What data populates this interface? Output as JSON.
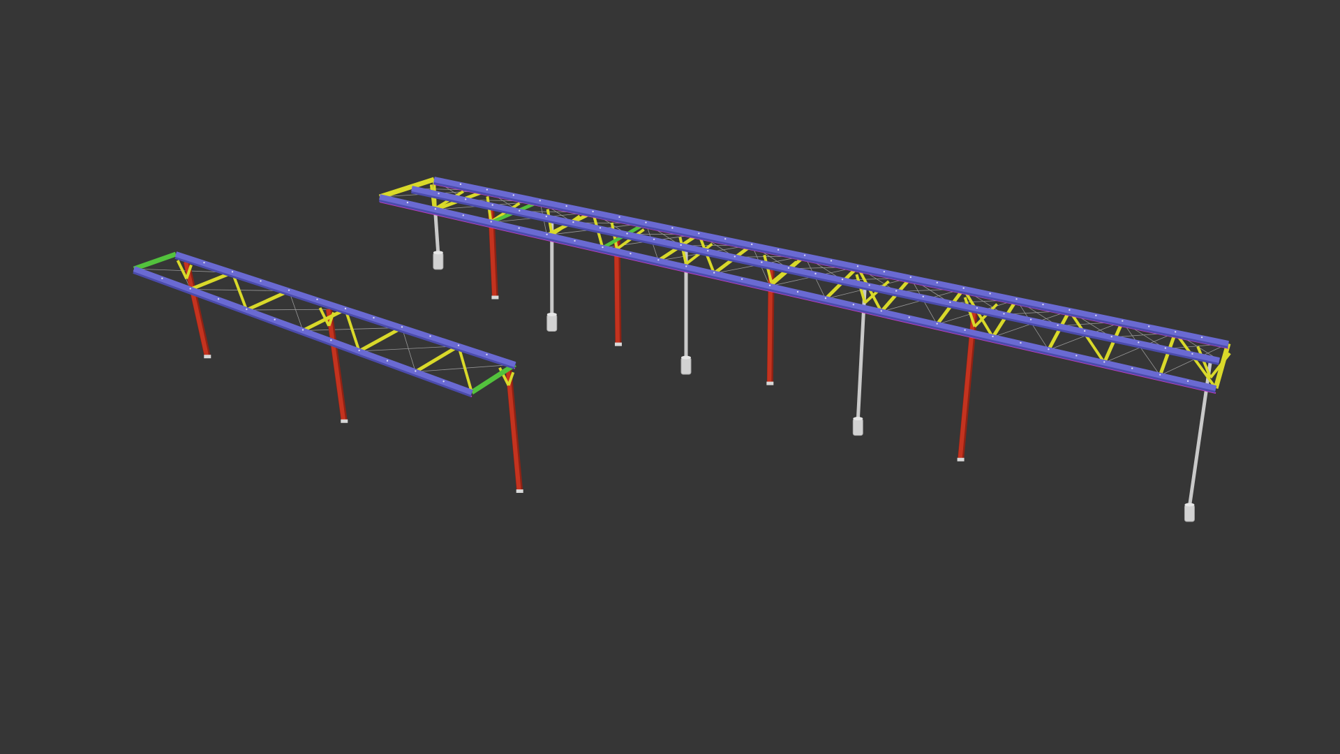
{
  "viewport": {
    "background_color": "#363636"
  },
  "palette": {
    "main_beam": "#6a6ad2",
    "main_beam_edge": "#4b4bab",
    "edge_trim": "#c23bc2",
    "cross_beam": "#d9d92a",
    "brace_green": "#53c23d",
    "column_red": "#c4331f",
    "column_red_dark": "#8e2214",
    "column_grey": "#c9c9c9",
    "pile_cap": "#d2d2d2",
    "deck_bracing": "#9a9a9a"
  },
  "structures": [
    {
      "id": "short-walkway",
      "bays": 6,
      "supports": [
        {
          "index": 0,
          "type": "steel-column"
        },
        {
          "index": 1,
          "type": "steel-column"
        },
        {
          "index": 2,
          "type": "steel-column"
        }
      ]
    },
    {
      "id": "long-walkway",
      "bays": 15,
      "supports": [
        {
          "index": 0,
          "type": "pipe-column-with-footing"
        },
        {
          "index": 1,
          "type": "steel-column"
        },
        {
          "index": 2,
          "type": "pipe-column-with-footing"
        },
        {
          "index": 3,
          "type": "steel-column"
        },
        {
          "index": 4,
          "type": "pipe-column-with-footing"
        },
        {
          "index": 5,
          "type": "steel-column"
        },
        {
          "index": 6,
          "type": "pipe-column-with-footing"
        },
        {
          "index": 7,
          "type": "steel-column"
        },
        {
          "index": 8,
          "type": "pipe-column-with-footing"
        }
      ]
    }
  ]
}
